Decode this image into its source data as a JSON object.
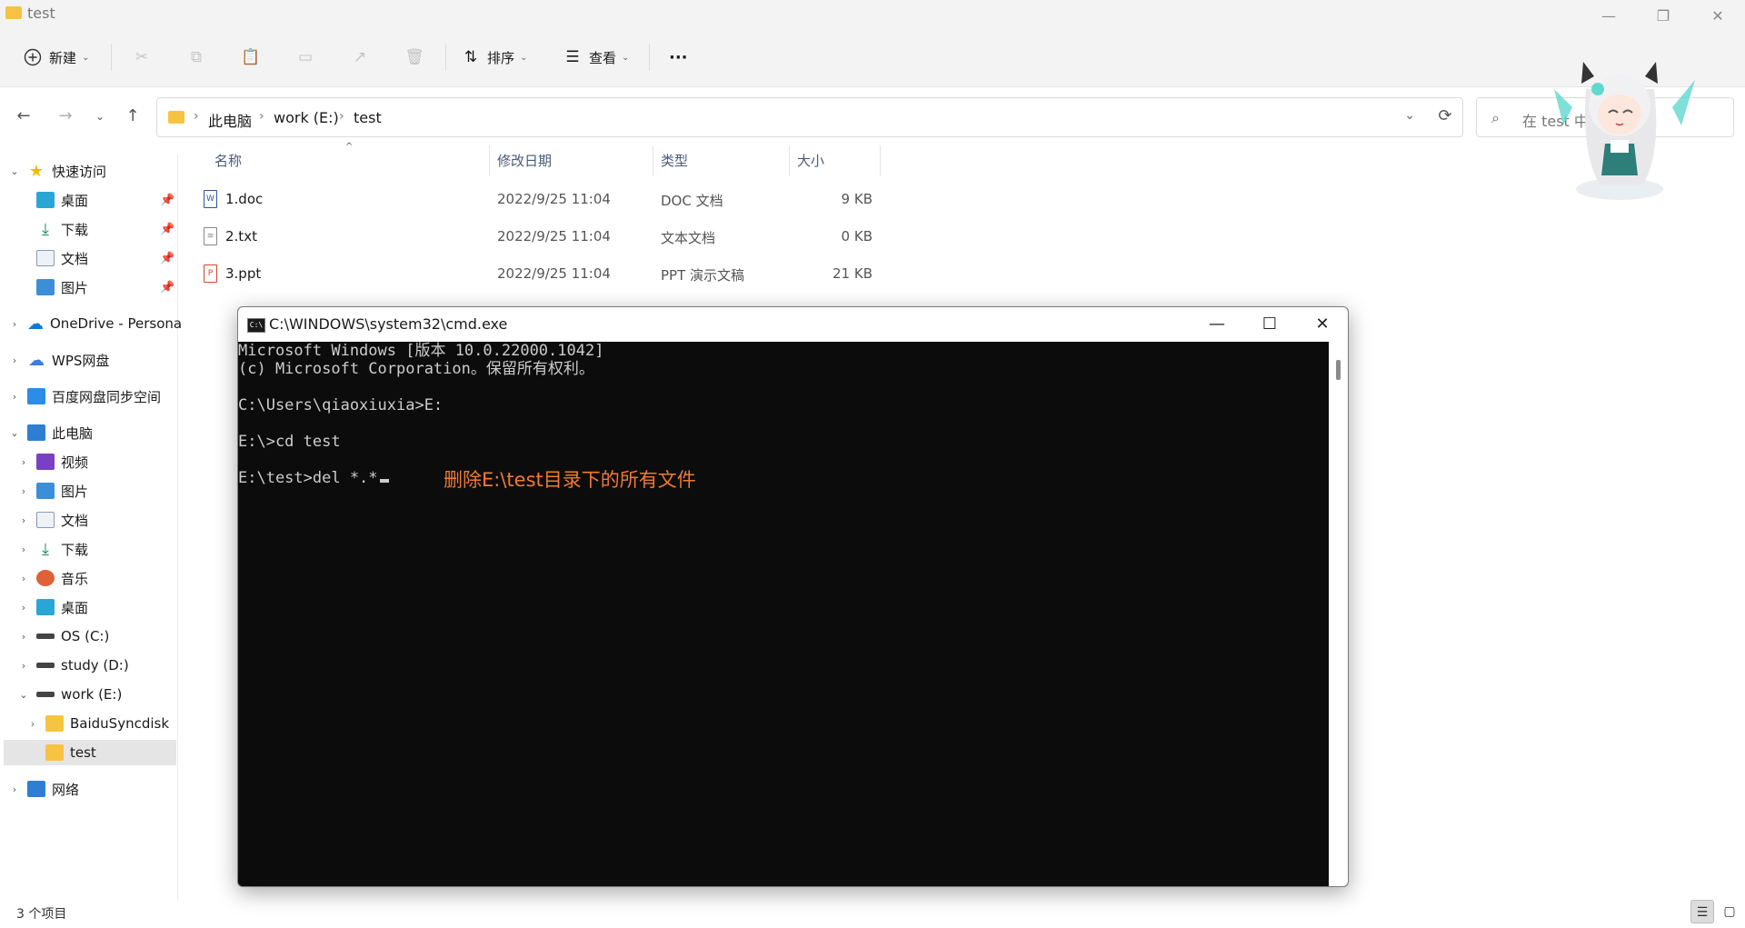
{
  "window": {
    "title": "test",
    "minimize": "—",
    "restore": "❐",
    "close": "✕"
  },
  "commandbar": {
    "new_label": "新建",
    "sort_label": "排序",
    "view_label": "查看",
    "more_label": "···"
  },
  "address": {
    "crumbs": [
      "此电脑",
      "work (E:)",
      "test"
    ],
    "search_placeholder": "在 test 中搜索"
  },
  "sidebar": {
    "quick_access": "快速访问",
    "quick_items": [
      "桌面",
      "下载",
      "文档",
      "图片"
    ],
    "onedrive": "OneDrive - Persona",
    "wps": "WPS网盘",
    "baidu": "百度网盘同步空间",
    "this_pc": "此电脑",
    "pc_items": [
      "视频",
      "图片",
      "文档",
      "下载",
      "音乐",
      "桌面",
      "OS (C:)",
      "study (D:)",
      "work (E:)"
    ],
    "e_children": [
      "BaiduSyncdisk",
      "test"
    ],
    "network": "网络"
  },
  "columns": {
    "name": "名称",
    "date": "修改日期",
    "type": "类型",
    "size": "大小"
  },
  "files": [
    {
      "name": "1.doc",
      "date": "2022/9/25 11:04",
      "type": "DOC 文档",
      "size": "9 KB",
      "icon": "doc-icon",
      "color": "#2b579a"
    },
    {
      "name": "2.txt",
      "date": "2022/9/25 11:04",
      "type": "文本文档",
      "size": "0 KB",
      "icon": "txt-icon",
      "color": "#666666"
    },
    {
      "name": "3.ppt",
      "date": "2022/9/25 11:04",
      "type": "PPT 演示文稿",
      "size": "21 KB",
      "icon": "ppt-icon",
      "color": "#d24726"
    }
  ],
  "status": {
    "count": "3 个项目"
  },
  "console": {
    "title": "C:\\WINDOWS\\system32\\cmd.exe",
    "lines": [
      "Microsoft Windows [版本 10.0.22000.1042]",
      "(c) Microsoft Corporation。保留所有权利。",
      "",
      "C:\\Users\\qiaoxiuxia>E:",
      "",
      "E:\\>cd test",
      "",
      "E:\\test>del *.*"
    ],
    "annotation": "删除E:\\test目录下的所有文件"
  },
  "colors": {
    "accent": "#0067c0",
    "annotation": "#f07a30",
    "console_bg": "#0c0c0c",
    "folder": "#f6c343"
  }
}
